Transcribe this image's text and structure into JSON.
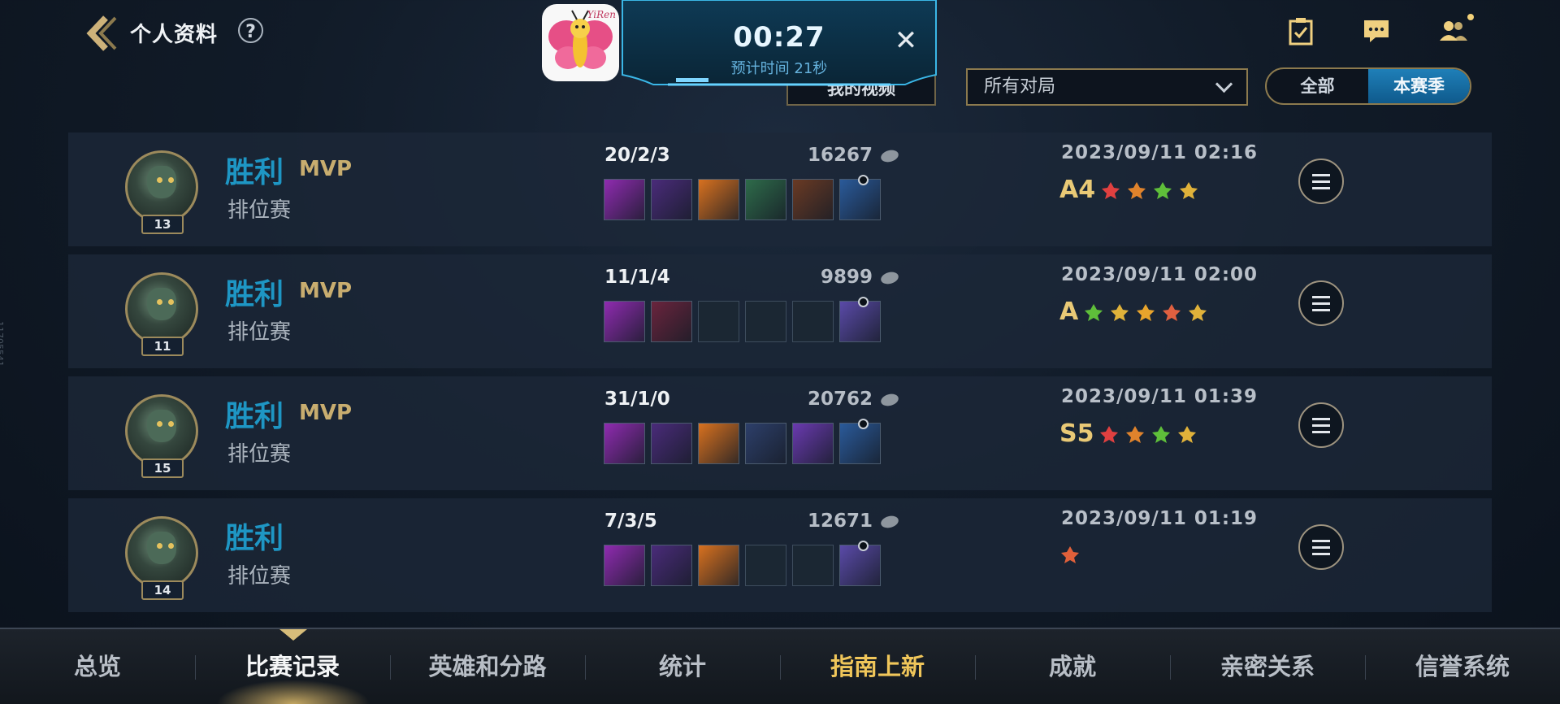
{
  "header": {
    "title": "个人资料",
    "help_label": "?",
    "my_video_label": "我的视频",
    "filter_value": "所有对局",
    "season_toggle": {
      "all_label": "全部",
      "season_label": "本赛季"
    },
    "app_badge_text": "YiRen"
  },
  "queue": {
    "time": "00:27",
    "estimate": "预计时间 21秒",
    "close_label": "✕"
  },
  "side_note": "11705541",
  "matches": [
    {
      "result": "胜利",
      "mvp": "MVP",
      "mode": "排位赛",
      "level": "13",
      "kda": "20/2/3",
      "gold": "16267",
      "date": "2023/09/11 02:16",
      "grade": "A4",
      "items": [
        "#8f2bb0",
        "#4a2b7a",
        "#d8711f",
        "#2e6b4a",
        "#6a3a24",
        "#2a5a9a"
      ],
      "badges": [
        "#e04040",
        "#e0832c",
        "#5fbf3a",
        "#e0b23a"
      ]
    },
    {
      "result": "胜利",
      "mvp": "MVP",
      "mode": "排位赛",
      "level": "11",
      "kda": "11/1/4",
      "gold": "9899",
      "date": "2023/09/11 02:00",
      "grade": "A",
      "items": [
        "#8f2bb0",
        "#6a243d",
        "",
        "",
        "",
        "#5a4aa8"
      ],
      "badges": [
        "#5fbf3a",
        "#e0b23a",
        "#e8a42c",
        "#e06040",
        "#e0b23a"
      ]
    },
    {
      "result": "胜利",
      "mvp": "MVP",
      "mode": "排位赛",
      "level": "15",
      "kda": "31/1/0",
      "gold": "20762",
      "date": "2023/09/11 01:39",
      "grade": "S5",
      "items": [
        "#8f2bb0",
        "#4a2b7a",
        "#d8711f",
        "#2d3f6a",
        "#6a3ab0",
        "#2a5a9a"
      ],
      "badges": [
        "#e04040",
        "#e0832c",
        "#5fbf3a",
        "#e0b23a"
      ]
    },
    {
      "result": "胜利",
      "mvp": "",
      "mode": "排位赛",
      "level": "14",
      "kda": "7/3/5",
      "gold": "12671",
      "date": "2023/09/11 01:19",
      "grade": "",
      "items": [
        "#8f2bb0",
        "#4a2b7a",
        "#d8711f",
        "",
        "",
        "#5a4aa8"
      ],
      "badges": [
        "#e0603a"
      ]
    }
  ],
  "tabs": [
    {
      "label": "总览"
    },
    {
      "label": "比赛记录"
    },
    {
      "label": "英雄和分路"
    },
    {
      "label": "统计"
    },
    {
      "label": "指南上新"
    },
    {
      "label": "成就"
    },
    {
      "label": "亲密关系"
    },
    {
      "label": "信誉系统"
    }
  ]
}
